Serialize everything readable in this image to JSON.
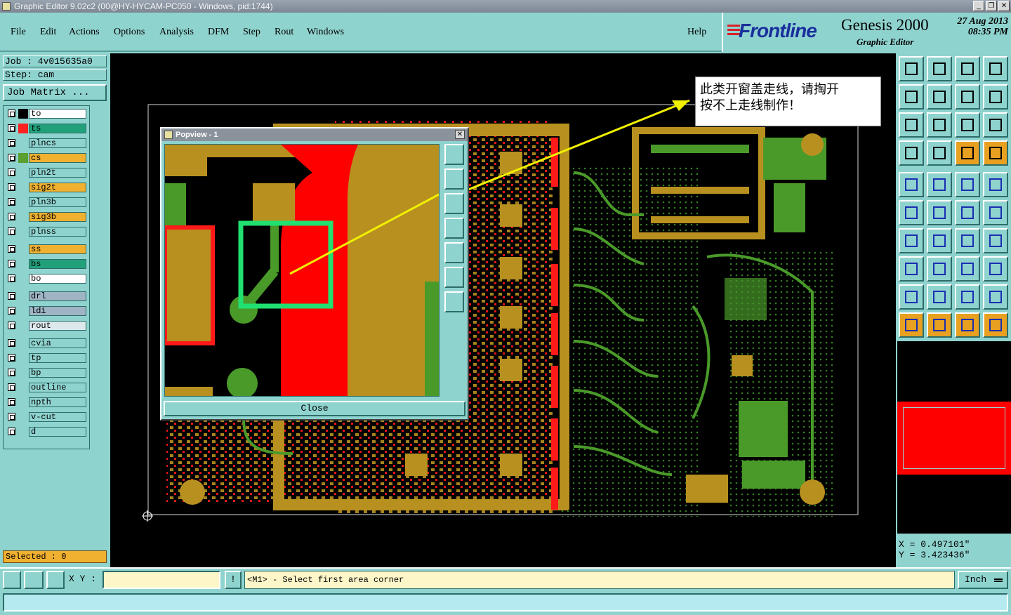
{
  "window": {
    "title": "Graphic Editor 9.02c2 (00@HY-HYCAM-PC050 - Windows, pid:1744)",
    "controls": [
      "_",
      "❐",
      "✕"
    ]
  },
  "menu": {
    "items": [
      {
        "label": "File"
      },
      {
        "label": "Edit"
      },
      {
        "label": "Actions"
      },
      {
        "label": "Options"
      },
      {
        "label": "Analysis"
      },
      {
        "label": "DFM"
      },
      {
        "label": "Step"
      },
      {
        "label": "Rout"
      },
      {
        "label": "Windows"
      }
    ],
    "help": "Help"
  },
  "brand": {
    "logo": "Frontline",
    "product": "Genesis 2000",
    "subtitle": "Graphic Editor",
    "date": "27  Aug 2013",
    "time": "08:35 PM"
  },
  "job": {
    "job_line": "Job : 4v015635a0",
    "step_line": "Step: cam",
    "matrix_button": "Job Matrix ..."
  },
  "layers": [
    {
      "name": "to",
      "color": "#ffffff",
      "sw": "#000000",
      "state": "display"
    },
    {
      "name": "ts",
      "color": "#21a07a",
      "sw": "#ff2020",
      "state": "work"
    },
    {
      "name": "plncs",
      "color": "#8fd3cf",
      "sw": "#8fd3cf",
      "state": ""
    },
    {
      "name": "cs",
      "color": "#f0b030",
      "sw": "#5aa030",
      "state": ""
    },
    {
      "name": "pln2t",
      "color": "#8fd3cf",
      "sw": "#8fd3cf",
      "state": ""
    },
    {
      "name": "sig2t",
      "color": "#f0b030",
      "sw": "#8fd3cf",
      "state": ""
    },
    {
      "name": "pln3b",
      "color": "#8fd3cf",
      "sw": "#8fd3cf",
      "state": ""
    },
    {
      "name": "sig3b",
      "color": "#f0b030",
      "sw": "#8fd3cf",
      "state": ""
    },
    {
      "name": "plnss",
      "color": "#8fd3cf",
      "sw": "#8fd3cf",
      "state": ""
    },
    {
      "name": "ss",
      "color": "#f0b030",
      "sw": "#8fd3cf",
      "state": ""
    },
    {
      "name": "bs",
      "color": "#21a07a",
      "sw": "#8fd3cf",
      "state": ""
    },
    {
      "name": "bo",
      "color": "#ffffff",
      "sw": "#8fd3cf",
      "state": ""
    },
    {
      "name": "drl",
      "color": "#9fb4c4",
      "sw": "#8fd3cf",
      "state": ""
    },
    {
      "name": "ldi",
      "color": "#9fb4c4",
      "sw": "#8fd3cf",
      "state": ""
    },
    {
      "name": "rout",
      "color": "#dde8ec",
      "sw": "#8fd3cf",
      "state": ""
    },
    {
      "name": "cvia",
      "color": "#8fd3cf",
      "sw": "#8fd3cf",
      "state": ""
    },
    {
      "name": "tp",
      "color": "#8fd3cf",
      "sw": "#8fd3cf",
      "state": ""
    },
    {
      "name": "bp",
      "color": "#8fd3cf",
      "sw": "#8fd3cf",
      "state": ""
    },
    {
      "name": "outline",
      "color": "#8fd3cf",
      "sw": "#8fd3cf",
      "state": ""
    },
    {
      "name": "npth",
      "color": "#8fd3cf",
      "sw": "#8fd3cf",
      "state": ""
    },
    {
      "name": "v-cut",
      "color": "#8fd3cf",
      "sw": "#8fd3cf",
      "state": ""
    },
    {
      "name": "d",
      "color": "#8fd3cf",
      "sw": "#8fd3cf",
      "state": ""
    }
  ],
  "selected": "Selected : 0",
  "popview": {
    "title": "Popview - 1",
    "close": "Close"
  },
  "annotation": {
    "line1": "此类开窗盖走线，请掏开",
    "line2": "按不上走线制作！"
  },
  "coords": {
    "x": "X = 0.497101\"",
    "y": "Y = 3.423436\""
  },
  "status": {
    "xy_label": "X Y :",
    "xy_value": "",
    "message": "<M1> - Select first area corner",
    "units": "Inch"
  },
  "colors": {
    "panel": "#8fd3cf",
    "copper": "#b89020",
    "mask": "#ff0000",
    "trace": "#4a9a2a",
    "arrow": "#f0f000",
    "highlight": "#20e070"
  }
}
